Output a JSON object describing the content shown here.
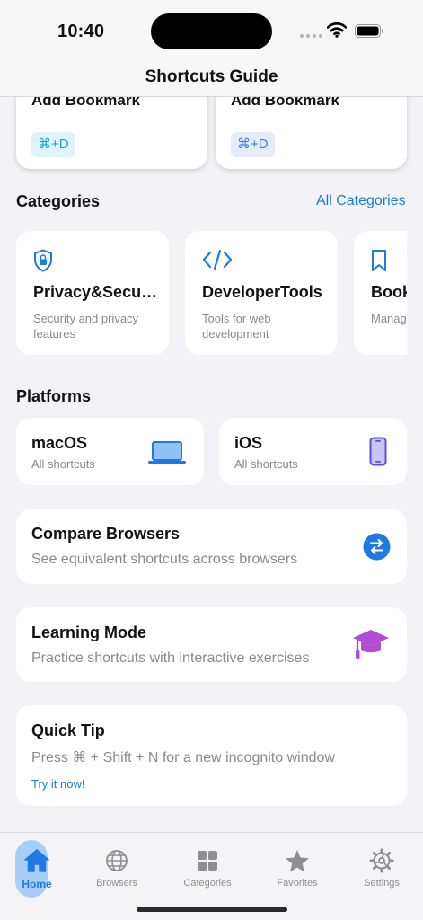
{
  "status": {
    "time": "10:40"
  },
  "nav": {
    "title": "Shortcuts Guide"
  },
  "top_cards": [
    {
      "label": "Add Bookmark",
      "shortcut": "⌘+D",
      "bg": "#dff4fa",
      "fg": "#1aa3c4"
    },
    {
      "label": "Add Bookmark",
      "shortcut": "⌘+D",
      "bg": "#e4ecf9",
      "fg": "#3d7ee0"
    }
  ],
  "categories": {
    "title": "Categories",
    "all_link": "All Categories",
    "items": [
      {
        "title": "Privacy&Security",
        "desc": "Security and privacy features",
        "icon": "shield-lock-icon"
      },
      {
        "title": "DeveloperTools",
        "desc": "Tools for web development",
        "icon": "code-icon"
      },
      {
        "title": "Bookmarks",
        "desc": "Manage bookmarks",
        "icon": "bookmark-icon"
      }
    ]
  },
  "platforms": {
    "title": "Platforms",
    "items": [
      {
        "title": "macOS",
        "sub": "All shortcuts",
        "icon": "laptop-icon"
      },
      {
        "title": "iOS",
        "sub": "All shortcuts",
        "icon": "phone-icon"
      }
    ]
  },
  "compare": {
    "title": "Compare Browsers",
    "sub": "See equivalent shortcuts across browsers",
    "icon": "arrows-swap-icon"
  },
  "learning": {
    "title": "Learning Mode",
    "sub": "Practice shortcuts with interactive exercises",
    "icon": "graduation-cap-icon"
  },
  "tip": {
    "title": "Quick Tip",
    "text": "Press ⌘ + Shift + N for a new incognito window",
    "action": "Try it now!"
  },
  "tabs": [
    {
      "label": "Home",
      "icon": "house-icon",
      "active": true
    },
    {
      "label": "Browsers",
      "icon": "globe-icon"
    },
    {
      "label": "Categories",
      "icon": "grid-icon"
    },
    {
      "label": "Favorites",
      "icon": "star-icon"
    },
    {
      "label": "Settings",
      "icon": "gear-icon"
    }
  ],
  "colors": {
    "accent": "#1e7ae0",
    "active_tab_bg": "#a8d0f7",
    "learning_icon": "#b04fd6"
  }
}
